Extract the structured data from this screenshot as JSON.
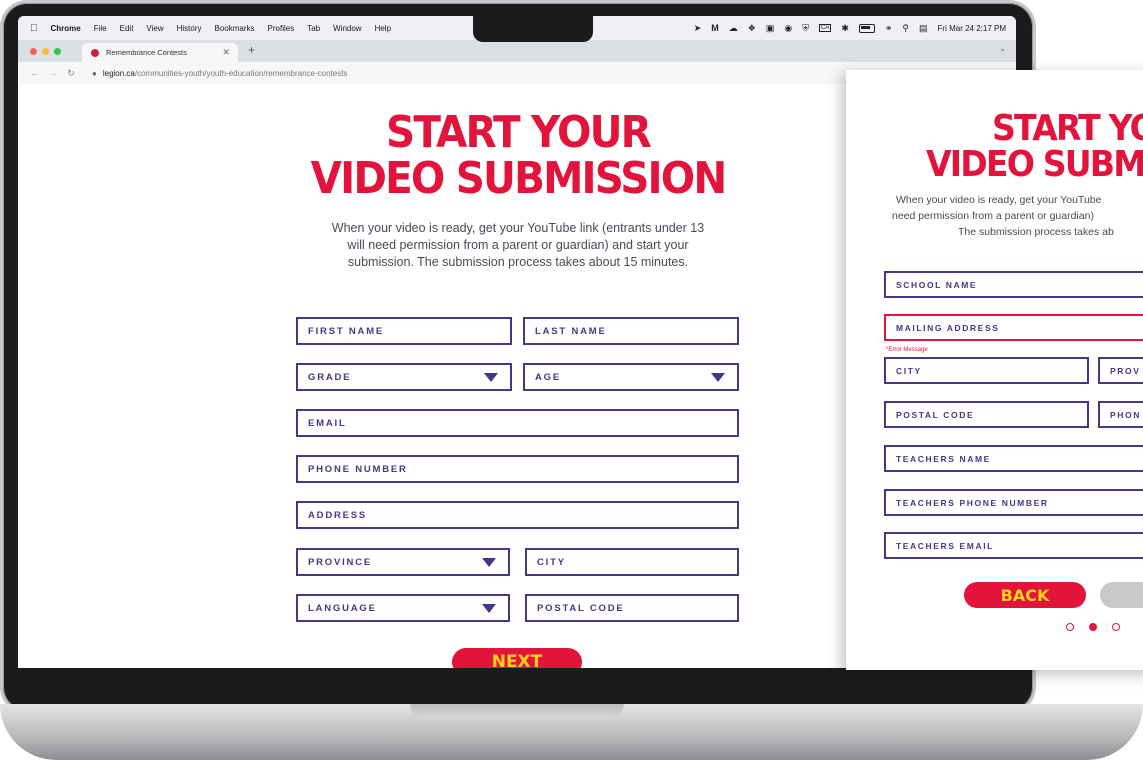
{
  "menubar": {
    "app": "Chrome",
    "items": [
      "File",
      "Edit",
      "View",
      "History",
      "Bookmarks",
      "Profiles",
      "Tab",
      "Window",
      "Help"
    ],
    "datetime": "Fri Mar 24  2:17 PM",
    "status_icons": [
      "location-icon",
      "m-icon",
      "cloud-icon",
      "dropbox-icon",
      "screen-icon",
      "record-icon",
      "shield-icon",
      "ca-icon",
      "bluetooth-icon",
      "battery-icon",
      "wifi-icon",
      "search-icon",
      "control-center-icon"
    ]
  },
  "browser": {
    "tab_title": "Remembrance Contests",
    "url_domain": "legion.ca",
    "url_path": "/communities-youth/youth-education/remembrance-contests"
  },
  "form1": {
    "title_line1": "START YOUR",
    "title_line2": "VIDEO SUBMISSION",
    "intro_line1": "When your video is ready, get your YouTube link (entrants under 13",
    "intro_line2": "will need permission from a parent or guardian) and start your",
    "intro_line3": "submission. The submission process takes about 15 minutes.",
    "fields": {
      "first_name": "FIRST NAME",
      "last_name": "LAST NAME",
      "grade": "GRADE",
      "age": "AGE",
      "email": "EMAIL",
      "phone": "PHONE NUMBER",
      "address": "ADDRESS",
      "province": "PROVINCE",
      "city": "CITY",
      "language": "LANGUAGE",
      "postal_code": "POSTAL CODE"
    },
    "next_label": "NEXT"
  },
  "form2": {
    "title_line1": "START YO",
    "title_line2": "VIDEO SUBM",
    "intro_line1": "When your video is ready, get your YouTube",
    "intro_line2": "need permission from a parent or guardian)",
    "intro_line3": "The submission process takes ab",
    "fields": {
      "school_name": "SCHOOL NAME",
      "mailing_address": "MAILING ADDRESS",
      "city": "CITY",
      "province": "PROV",
      "postal_code": "POSTAL CODE",
      "phone": "PHON",
      "teachers_name": "TEACHERS NAME",
      "teachers_phone": "TEACHERS PHONE NUMBER",
      "teachers_email": "TEACHERS EMAIL"
    },
    "error_message": "*Error Message",
    "back_label": "BACK",
    "steps": {
      "total": 3,
      "current": 2
    }
  },
  "colors": {
    "brand_red": "#e3143c",
    "field_blue": "#3e3a86",
    "button_text_yellow": "#ffd21a",
    "disabled_grey": "#c9c9cc"
  }
}
